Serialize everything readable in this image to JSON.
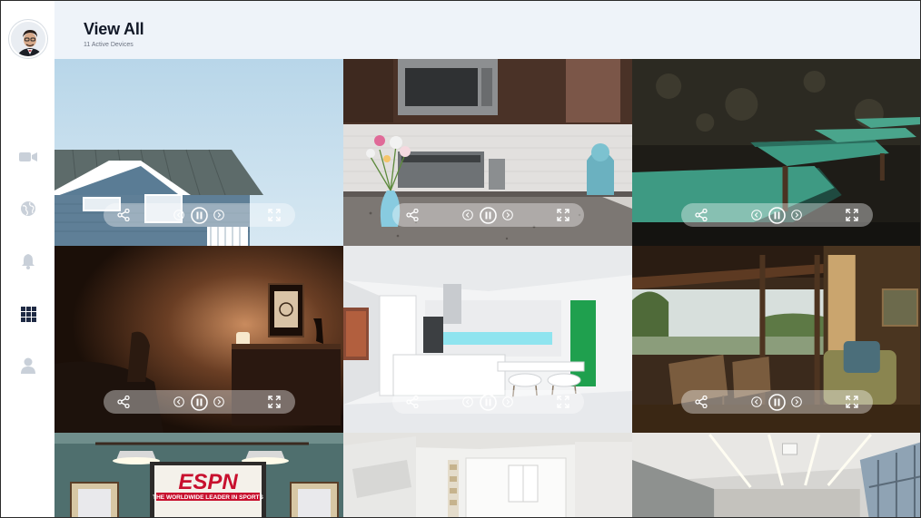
{
  "header": {
    "title": "View All",
    "subtitle": "11 Active Devices"
  },
  "sidebar": {
    "items": [
      {
        "name": "camera",
        "icon": "video-camera-icon",
        "active": false
      },
      {
        "name": "globe",
        "icon": "globe-icon",
        "active": false
      },
      {
        "name": "alerts",
        "icon": "bell-icon",
        "active": false
      },
      {
        "name": "grid",
        "icon": "grid-icon",
        "active": true
      },
      {
        "name": "profile",
        "icon": "user-icon",
        "active": false
      }
    ]
  },
  "controls": {
    "share_icon": "share-icon",
    "prev_icon": "chevron-left-icon",
    "pause_icon": "pause-icon",
    "next_icon": "chevron-right-icon",
    "fullscreen_icon": "fullscreen-icon"
  },
  "colors": {
    "header_bg": "#eef3f9",
    "icon_inactive": "#c9d0d9",
    "icon_active": "#1f2a44",
    "control_bar": "rgba(255,255,255,0.38)"
  },
  "feeds": [
    {
      "scene": "house-exterior"
    },
    {
      "scene": "kitchen-counter"
    },
    {
      "scene": "billiards-room"
    },
    {
      "scene": "dim-bedroom"
    },
    {
      "scene": "modern-kitchen"
    },
    {
      "scene": "porch-lounge"
    },
    {
      "scene": "espn-sports-bar"
    },
    {
      "scene": "white-kitchen"
    },
    {
      "scene": "office-ceiling"
    }
  ]
}
